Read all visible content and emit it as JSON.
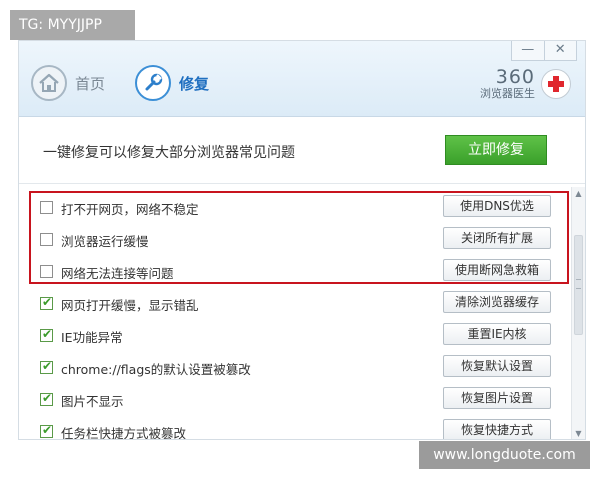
{
  "overlay": {
    "tg_badge": "TG: MYYJJPP",
    "watermark": "www.longduote.com"
  },
  "window_controls": {
    "minimize": "—",
    "close": "✕"
  },
  "nav": {
    "home_label": "首页",
    "repair_label": "修复"
  },
  "brand": {
    "number": "360",
    "subtitle": "浏览器医生"
  },
  "headline": {
    "text": "一键修复可以修复大部分浏览器常见问题",
    "fix_button": "立即修复"
  },
  "issues": [
    {
      "label": "打不开网页，网络不稳定",
      "checked": false,
      "action": "使用DNS优选"
    },
    {
      "label": "浏览器运行缓慢",
      "checked": false,
      "action": "关闭所有扩展"
    },
    {
      "label": "网络无法连接等问题",
      "checked": false,
      "action": "使用断网急救箱"
    },
    {
      "label": "网页打开缓慢，显示错乱",
      "checked": true,
      "action": "清除浏览器缓存"
    },
    {
      "label": "IE功能异常",
      "checked": true,
      "action": "重置IE内核"
    },
    {
      "label": "chrome://flags的默认设置被篡改",
      "checked": true,
      "action": "恢复默认设置"
    },
    {
      "label": "图片不显示",
      "checked": true,
      "action": "恢复图片设置"
    },
    {
      "label": "任务栏快捷方式被篡改",
      "checked": true,
      "action": "恢复快捷方式"
    }
  ],
  "colors": {
    "accent_blue": "#1f6fc0",
    "fix_green": "#3aa02a",
    "highlight_red": "#c8141e",
    "check_green": "#3b9b2b"
  }
}
